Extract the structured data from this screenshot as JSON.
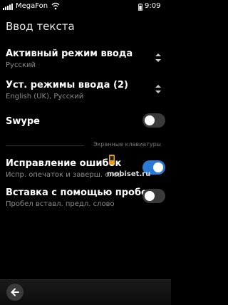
{
  "statusbar": {
    "carrier": "MegaFon",
    "time": "9:09"
  },
  "page": {
    "title": "Ввод текста"
  },
  "items": [
    {
      "label": "Активный режим ввода",
      "sub": "Русский"
    },
    {
      "label": "Уст. режимы ввода (2)",
      "sub": "English (UK), Русский"
    },
    {
      "label": "Swype",
      "toggle": "off"
    },
    {
      "label": "Исправление ошибок",
      "sub": "Испр. опечаток и заверш. слов",
      "toggle": "on"
    },
    {
      "label": "Вставка с помощью пробела",
      "sub": "Пробел вставл. предл. слово",
      "toggle": "off"
    }
  ],
  "section": {
    "header": "Экранные клавиатуры"
  },
  "watermark": "mobiset.ru",
  "colors": {
    "accent": "#2a7ad5",
    "background": "#000000"
  },
  "icons": {
    "back": "arrow-left",
    "chevrons": "up-down",
    "signal": "signal-bars",
    "wifi": "wifi",
    "battery": "battery"
  }
}
